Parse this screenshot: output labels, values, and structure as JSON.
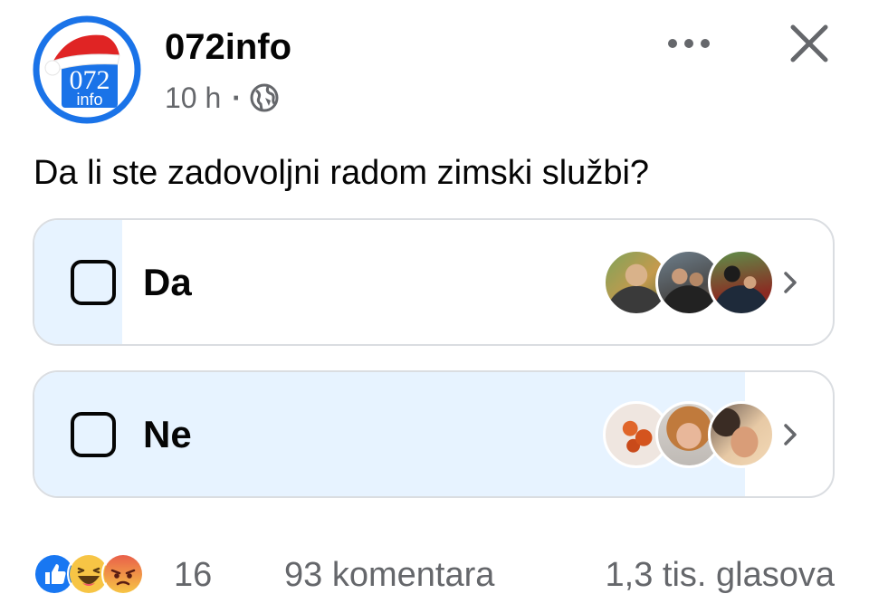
{
  "post": {
    "author": "072info",
    "logo_text_top": "072",
    "logo_text_bottom": "info",
    "time": "10 h",
    "separator": "·",
    "audience_icon": "globe-icon",
    "more_icon": "more-horizontal-icon",
    "close_icon": "close-icon"
  },
  "poll": {
    "question": "Da li ste zadovoljni radom zimski službi?",
    "options": [
      {
        "label": "Da",
        "vote_share": 0.11,
        "voter_avatars": 3
      },
      {
        "label": "Ne",
        "vote_share": 0.89,
        "voter_avatars": 3
      }
    ]
  },
  "footer": {
    "reaction_icons": [
      "like-icon",
      "haha-icon",
      "angry-icon"
    ],
    "reaction_count": "16",
    "comments": "93 komentara",
    "votes": "1,3 tis. glasova"
  },
  "colors": {
    "poll_fill": "#e7f3ff",
    "border": "#dadde1",
    "secondary_text": "#65676b",
    "logo_blue": "#1a73e8",
    "like_blue": "#1877f2",
    "angry_red": "#e9604a",
    "haha_yellow": "#f7c545"
  }
}
